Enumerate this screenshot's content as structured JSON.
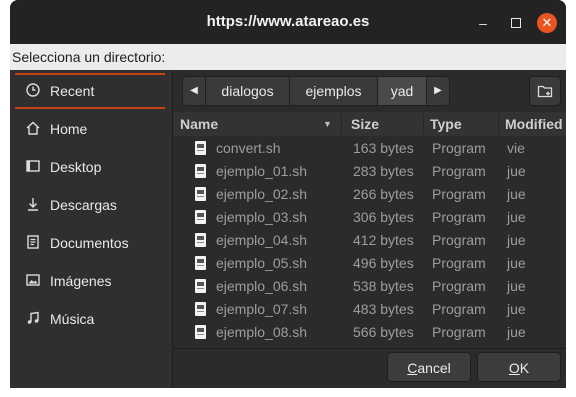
{
  "window": {
    "title": "https://www.atareao.es",
    "prompt": "Selecciona un directorio:"
  },
  "sidebar": {
    "items": [
      {
        "label": "Recent",
        "icon": "clock-icon"
      },
      {
        "label": "Home",
        "icon": "home-icon"
      },
      {
        "label": "Desktop",
        "icon": "desktop-icon"
      },
      {
        "label": "Descargas",
        "icon": "download-icon"
      },
      {
        "label": "Documentos",
        "icon": "document-icon"
      },
      {
        "label": "Imágenes",
        "icon": "image-icon"
      },
      {
        "label": "Música",
        "icon": "music-icon"
      }
    ]
  },
  "pathbar": {
    "segments": [
      "dialogos",
      "ejemplos",
      "yad"
    ]
  },
  "table": {
    "columns": [
      "Name",
      "Size",
      "Type",
      "Modified"
    ],
    "rows": [
      {
        "name": "convert.sh",
        "size": "163 bytes",
        "type": "Program",
        "modified": "vie"
      },
      {
        "name": "ejemplo_01.sh",
        "size": "283 bytes",
        "type": "Program",
        "modified": "jue"
      },
      {
        "name": "ejemplo_02.sh",
        "size": "266 bytes",
        "type": "Program",
        "modified": "jue"
      },
      {
        "name": "ejemplo_03.sh",
        "size": "306 bytes",
        "type": "Program",
        "modified": "jue"
      },
      {
        "name": "ejemplo_04.sh",
        "size": "412 bytes",
        "type": "Program",
        "modified": "jue"
      },
      {
        "name": "ejemplo_05.sh",
        "size": "496 bytes",
        "type": "Program",
        "modified": "jue"
      },
      {
        "name": "ejemplo_06.sh",
        "size": "538 bytes",
        "type": "Program",
        "modified": "jue"
      },
      {
        "name": "ejemplo_07.sh",
        "size": "483 bytes",
        "type": "Program",
        "modified": "jue"
      },
      {
        "name": "ejemplo_08.sh",
        "size": "566 bytes",
        "type": "Program",
        "modified": "jue"
      }
    ]
  },
  "buttons": {
    "cancel": {
      "label_prefix": "",
      "mnemonic": "C",
      "label_rest": "ancel"
    },
    "ok": {
      "label_prefix": "",
      "mnemonic": "O",
      "label_rest": "K"
    }
  },
  "colors": {
    "accent": "#e95420",
    "window_bg": "#2b2b2b",
    "titlebar_bg": "#232323"
  }
}
